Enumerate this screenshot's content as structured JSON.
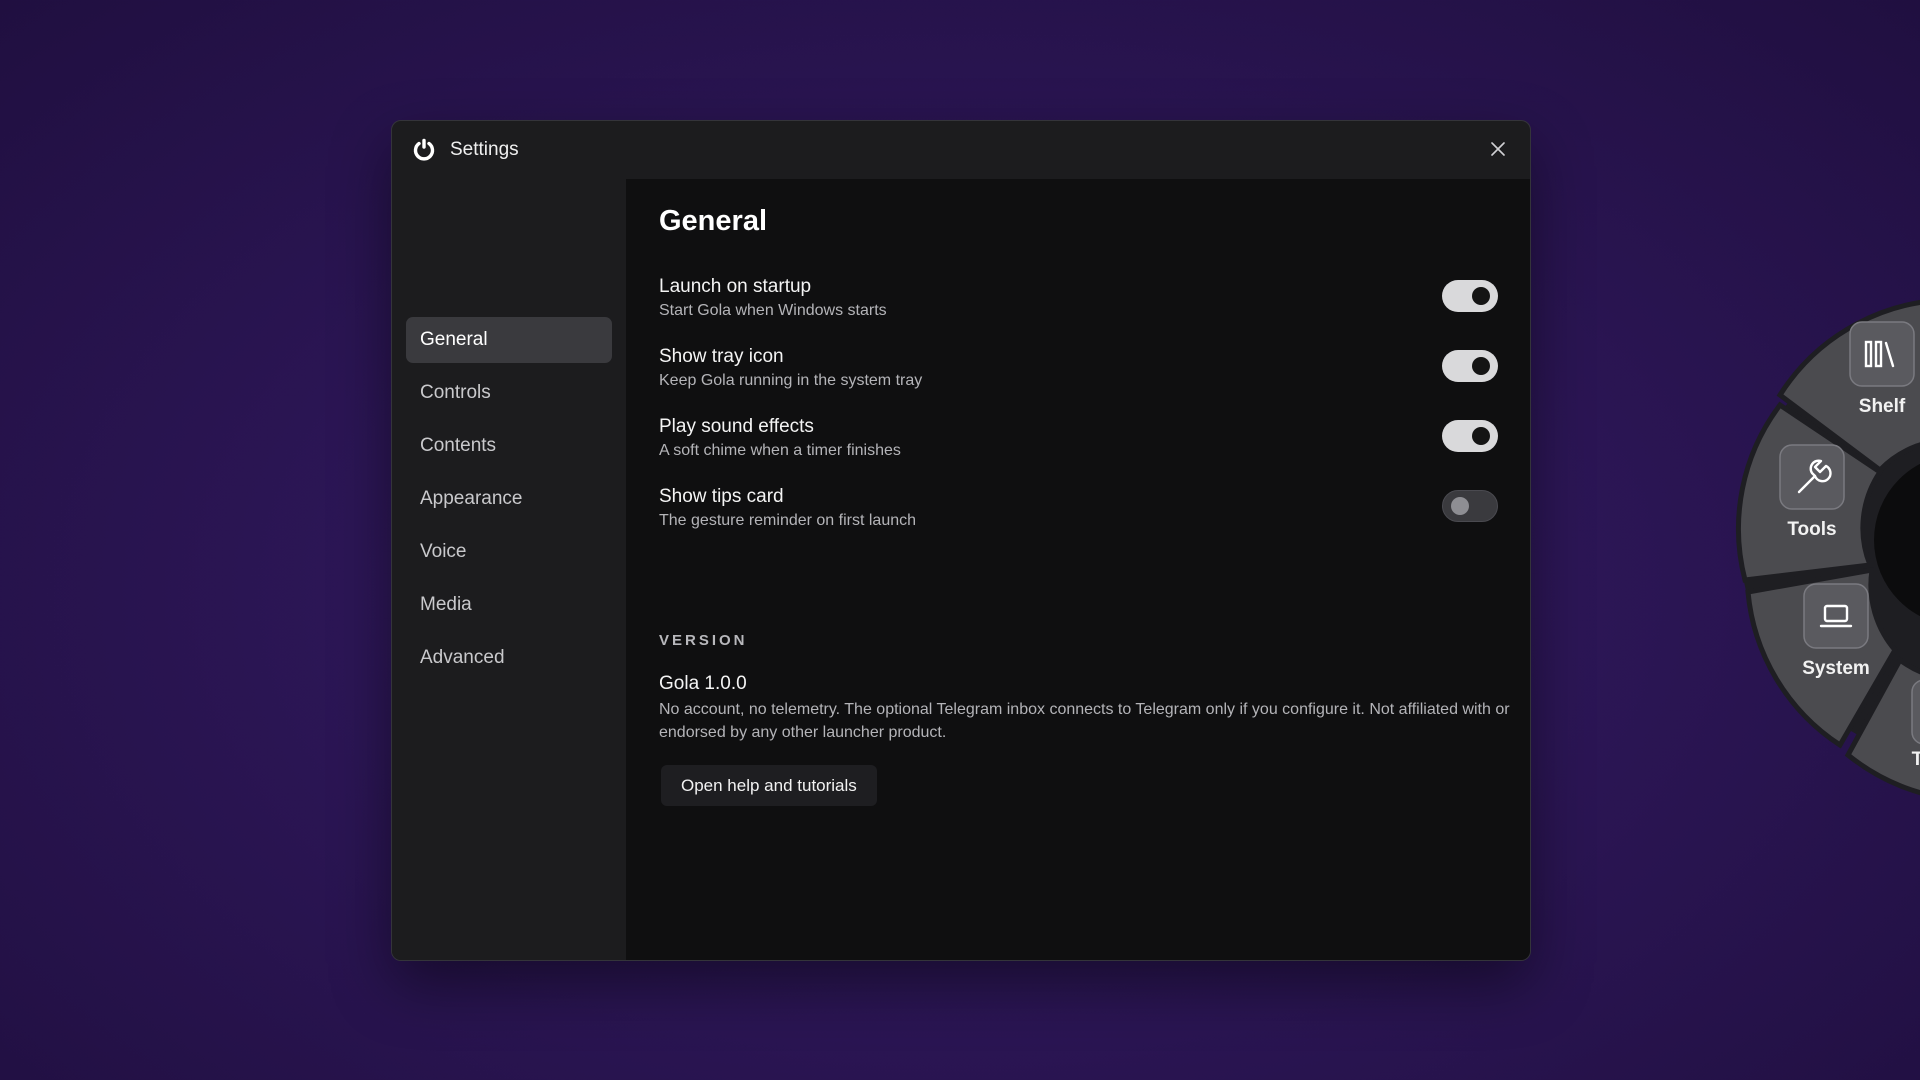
{
  "window": {
    "title": "Settings",
    "logo_icon": "gola-logo-icon",
    "close_icon": "close-icon"
  },
  "sidebar": {
    "items": [
      {
        "label": "General",
        "active": true
      },
      {
        "label": "Controls",
        "active": false
      },
      {
        "label": "Contents",
        "active": false
      },
      {
        "label": "Appearance",
        "active": false
      },
      {
        "label": "Voice",
        "active": false
      },
      {
        "label": "Media",
        "active": false
      },
      {
        "label": "Advanced",
        "active": false
      }
    ]
  },
  "main": {
    "title": "General",
    "settings": [
      {
        "label": "Launch on startup",
        "description": "Start Gola when Windows starts",
        "enabled": true
      },
      {
        "label": "Show tray icon",
        "description": "Keep Gola running in the system tray",
        "enabled": true
      },
      {
        "label": "Play sound effects",
        "description": "A soft chime when a timer finishes",
        "enabled": true
      },
      {
        "label": "Show tips card",
        "description": "The gesture reminder on first launch",
        "enabled": false
      }
    ],
    "version_section": {
      "heading": "VERSION",
      "name": "Gola 1.0.0",
      "note": "No account, no telemetry. The optional Telegram inbox connects to Telegram only if you configure it. Not affiliated with or endorsed by any other launcher product.",
      "help_button_label": "Open help and tutorials"
    }
  },
  "radial_menu": {
    "items": [
      {
        "label": "Shelf",
        "icon": "books-icon"
      },
      {
        "label": "Tools",
        "icon": "wrench-icon"
      },
      {
        "label": "System",
        "icon": "laptop-icon"
      },
      {
        "label": "Te",
        "icon": "partial-icon"
      }
    ]
  },
  "colors": {
    "background": "#2c1656",
    "window": "#1c1c1e",
    "content": "#0f0f10",
    "active_nav": "#3a3a3e",
    "toggle_on": "#d9d9db"
  }
}
